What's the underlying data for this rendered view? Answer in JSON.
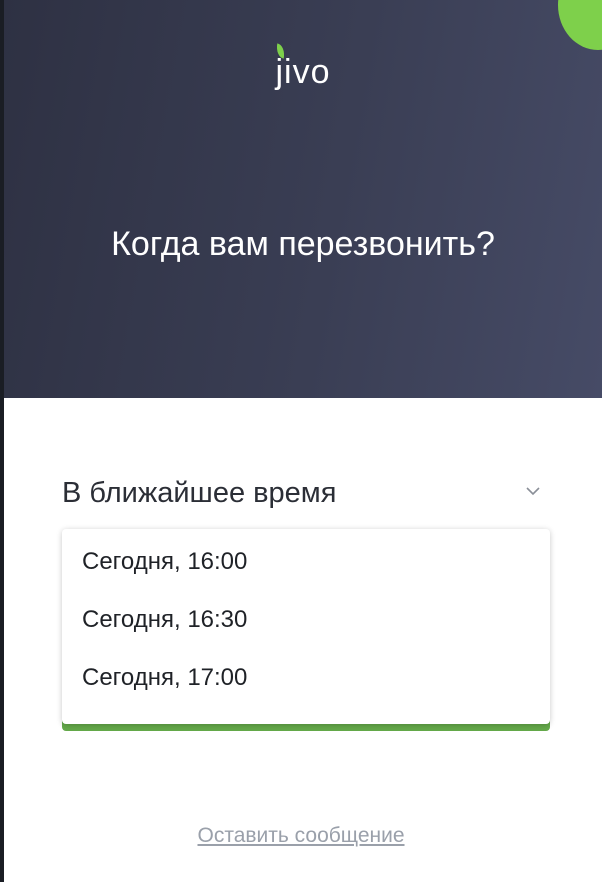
{
  "widget": {
    "logo_text": "jivo",
    "title": "Когда вам перезвонить?"
  },
  "time_select": {
    "selected": "В ближайшее время",
    "options": [
      "Сегодня, 16:00",
      "Сегодня, 16:30",
      "Сегодня, 17:00"
    ]
  },
  "footer": {
    "leave_message_link": "Оставить сообщение"
  },
  "colors": {
    "header_bg": "#3a3e54",
    "accent_green": "#7ed04b",
    "button_green": "#64a94a",
    "link_gray": "#9aa0aa"
  },
  "icons": {
    "dropdown_arrow": "chevron-down-icon",
    "logo_leaf": "leaf-icon"
  }
}
